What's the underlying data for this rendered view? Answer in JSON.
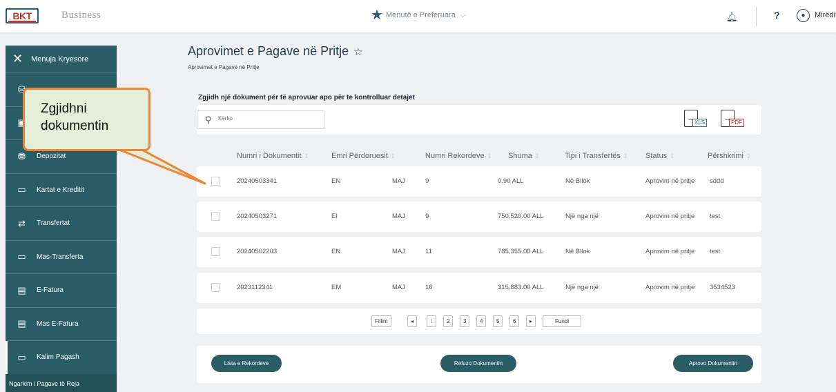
{
  "header": {
    "logo_text": "BKT",
    "brand_word": "Business",
    "favorites_label": "Menutë e Preferuara",
    "help_label": "?",
    "greeting": "Mirëdit"
  },
  "sidebar": {
    "title": "Menuja Kryesore",
    "items": [
      {
        "label": "",
        "icon": "coins-icon"
      },
      {
        "label": "",
        "icon": "account-icon"
      },
      {
        "label": "Depozitat",
        "icon": "deposit-icon"
      },
      {
        "label": "Kartat e Kreditit",
        "icon": "card-icon"
      },
      {
        "label": "Transfertat",
        "icon": "transfer-icon"
      },
      {
        "label": "Mas-Transferta",
        "icon": "card-icon"
      },
      {
        "label": "E-Fatura",
        "icon": "invoice-icon"
      },
      {
        "label": "Mas E-Fatura",
        "icon": "invoice-icon"
      },
      {
        "label": "Kalim Pagash",
        "icon": "card-icon"
      }
    ],
    "footer": "Ngarkim i Pagave të Reja"
  },
  "main": {
    "title": "Aprovimet e Pagave në Pritje",
    "breadcrumb": "Aprovimet e Pagave në Pritje",
    "prompt": "Zgjidh një dokument për të aprovuar apo për te kontrolluar detajet",
    "search_placeholder": "Kërko",
    "export_xls": "XLS",
    "export_pdf": "PDF",
    "columns": [
      "Numri i Dokumentit",
      "Emri Përdoruesit",
      "Numri Rekordeve",
      "Shuma",
      "Tipi i Transfertës",
      "Status",
      "Përshkrimi"
    ],
    "rows": [
      {
        "doc": "20240503341",
        "user": "E​N",
        "user2": "MAJ",
        "records": "9",
        "amount": "0.90 ALL",
        "type": "Në Bllok",
        "status": "Aprovim në pritje",
        "desc": "sddd"
      },
      {
        "doc": "20240503271",
        "user": "EI",
        "user2": "MAJ",
        "records": "9",
        "amount": "750,520.00 ALL",
        "type": "Një nga një",
        "status": "Aprovim në pritje",
        "desc": "test"
      },
      {
        "doc": "20240502203",
        "user": "EN",
        "user2": "MAJ",
        "records": "11",
        "amount": "785,355.00 ALL",
        "type": "Në Bllok",
        "status": "Aprovim në pritje",
        "desc": "test"
      },
      {
        "doc": "2023112341",
        "user": "EM",
        "user2": "MAJ",
        "records": "16",
        "amount": "315,883.00 ALL",
        "type": "Një nga një",
        "status": "Aprovim në pritje",
        "desc": "3534523"
      }
    ],
    "pager": {
      "first": "Fillim",
      "prev": "◂",
      "pages": [
        "1",
        "2",
        "3",
        "4",
        "5",
        "6"
      ],
      "next": "▸",
      "last": "Fundi"
    },
    "actions": {
      "list": "Lista e Rekordeve",
      "reject": "Refuzo Dokumentin",
      "approve": "Aprovo Dokumentin"
    }
  },
  "callout": {
    "line1": "Zgjidhni",
    "line2": "dokumentin"
  },
  "colors": {
    "accent": "#2b5d66",
    "callout_border": "#e9863a",
    "callout_fill": "#e3edd7"
  }
}
